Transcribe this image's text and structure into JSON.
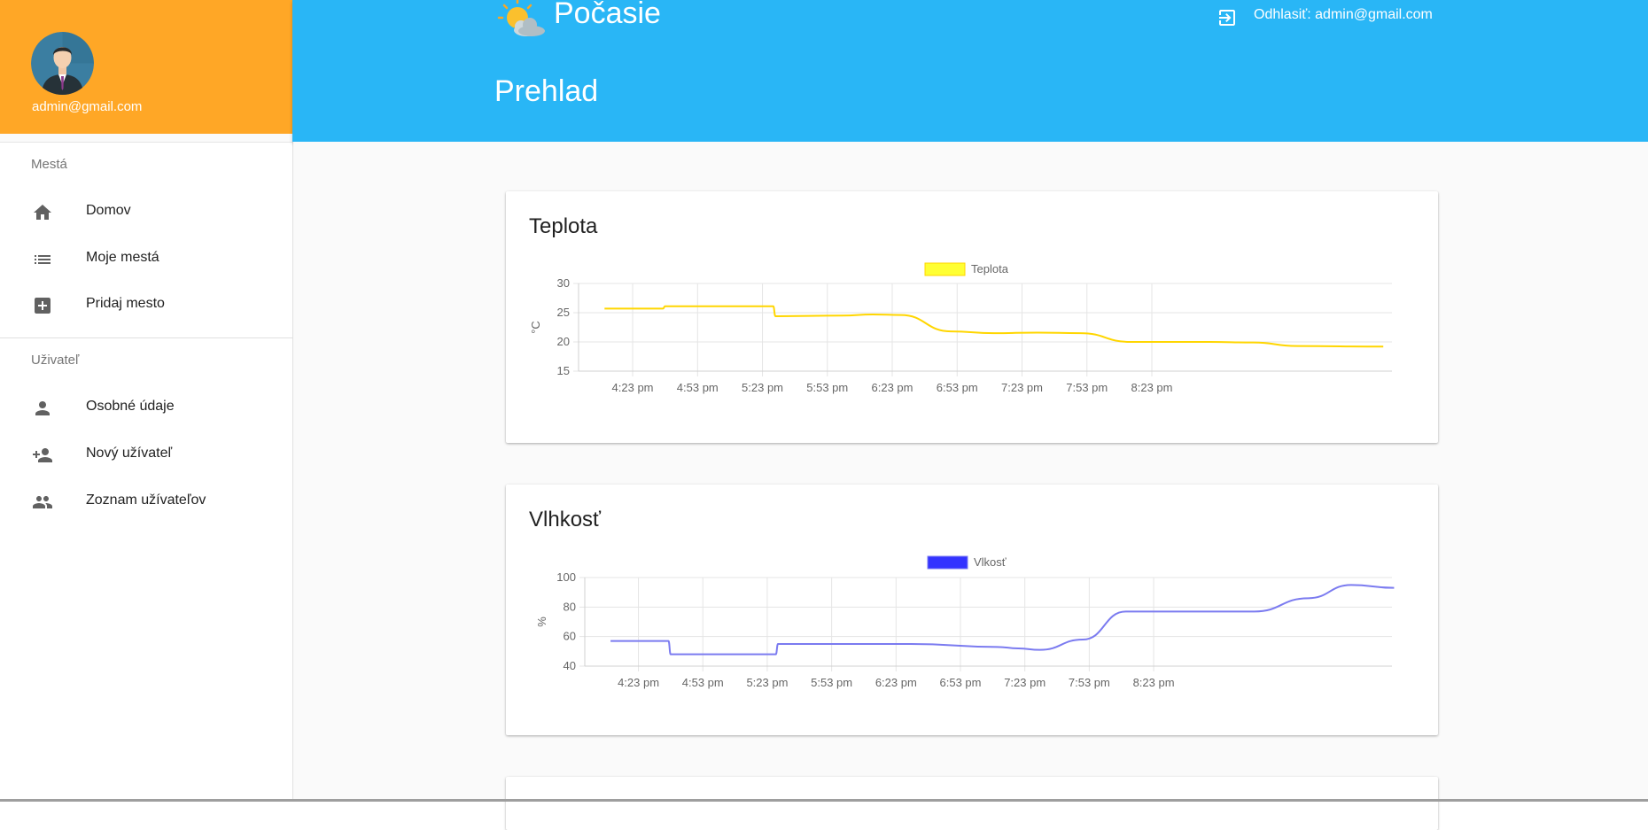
{
  "app": {
    "title": "Počasie",
    "logout_label": "Odhlasiť: admin@gmail.com",
    "page_title": "Prehlad"
  },
  "colors": {
    "sidebar_header": "#ffa726",
    "topbar": "#29b6f6",
    "temperature_line": "#ffd600",
    "temperature_legend_fill": "#ffff33",
    "humidity_line": "#7b7bf0",
    "humidity_legend_fill": "#3333ff"
  },
  "user": {
    "email": "admin@gmail.com"
  },
  "sidebar": {
    "section_cities": "Mestá",
    "section_user": "Uživateľ",
    "items": [
      {
        "label": "Domov",
        "icon": "home-icon"
      },
      {
        "label": "Moje mestá",
        "icon": "list-icon"
      },
      {
        "label": "Pridaj mesto",
        "icon": "add-box-icon"
      },
      {
        "label": "Osobné údaje",
        "icon": "person-icon"
      },
      {
        "label": "Nový užívateľ",
        "icon": "person-add-icon"
      },
      {
        "label": "Zoznam užívateľov",
        "icon": "people-icon"
      }
    ]
  },
  "cards": [
    {
      "title": "Teplota"
    },
    {
      "title": "Vlhkosť"
    }
  ],
  "chart_data": [
    {
      "type": "line",
      "legend": "Teplota",
      "ylabel": "°C",
      "ylim": [
        15,
        30
      ],
      "yticks": [
        15,
        20,
        25,
        30
      ],
      "xticks": [
        "4:23 pm",
        "4:53 pm",
        "5:23 pm",
        "5:53 pm",
        "6:23 pm",
        "6:53 pm",
        "7:23 pm",
        "7:53 pm",
        "8:23 pm"
      ],
      "x_minutes": [
        240,
        267,
        268,
        318,
        319,
        350,
        364,
        377,
        400,
        420,
        440,
        460,
        483,
        520,
        540,
        560,
        600
      ],
      "y": [
        25.7,
        25.7,
        26.1,
        26.1,
        24.4,
        24.5,
        24.7,
        24.6,
        21.8,
        21.5,
        21.6,
        21.5,
        20.0,
        20.0,
        19.9,
        19.3,
        19.2
      ]
    },
    {
      "type": "line",
      "legend": "Vlkosť",
      "ylabel": "%",
      "ylim": [
        40,
        100
      ],
      "yticks": [
        40,
        60,
        80,
        100
      ],
      "xticks": [
        "4:23 pm",
        "4:53 pm",
        "5:23 pm",
        "5:53 pm",
        "6:23 pm",
        "6:53 pm",
        "7:23 pm",
        "7:53 pm",
        "8:23 pm"
      ],
      "x_minutes": [
        240,
        267,
        268,
        317,
        318,
        340,
        380,
        420,
        430,
        440,
        460,
        480,
        500,
        540,
        565,
        585,
        605
      ],
      "y": [
        57,
        57,
        48,
        48,
        55,
        55,
        55,
        53,
        52,
        51,
        58,
        77,
        77,
        77,
        86,
        95,
        93
      ]
    }
  ]
}
